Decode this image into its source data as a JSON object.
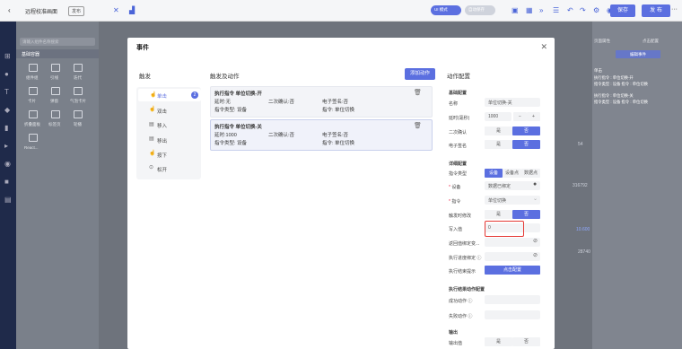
{
  "topbar": {
    "back": "‹",
    "title": "远程校准画面",
    "badge": "发布",
    "toggle1": "UI 模式",
    "toggle2": "自动保存",
    "save": "保存",
    "publish": "发 布",
    "more": "···"
  },
  "left": {
    "search_placeholder": "请输入组件名称搜索",
    "section": "基础容器",
    "items": [
      "组件组",
      "引线",
      "迭代",
      "卡片",
      "弹窗",
      "气泡卡片",
      "折叠面板",
      "标签页",
      "轮播",
      "React..."
    ]
  },
  "right": {
    "tab1": "页面属性",
    "tab2": "点击配置",
    "edit_btn": "编辑事件",
    "lines": [
      "单击",
      "执行指令 : 单位切换-开",
      "指令类型 : 设备    指令 : 单位切换",
      "执行指令 : 单位切换-关",
      "指令类型 : 设备    指令 : 单位切换"
    ]
  },
  "canvas": {
    "vals": [
      "54",
      "316792",
      "10.600",
      "28740"
    ]
  },
  "modal": {
    "title": "事件",
    "close": "✕",
    "trigger_h": "触发",
    "triggers": [
      {
        "label": "单击",
        "count": "2"
      },
      {
        "label": "双击"
      },
      {
        "label": "移入"
      },
      {
        "label": "移出"
      },
      {
        "label": "按下"
      },
      {
        "label": "松开"
      }
    ],
    "actions_h": "触发及动作",
    "add_btn": "添加动作",
    "cards": [
      {
        "title": "执行指令   单位切换-开",
        "delay": "延时:无",
        "confirm": "二次确认:否",
        "sign": "电子签名:否",
        "type": "指令类型: 设备",
        "cmd": "指令: 单位切换"
      },
      {
        "title": "执行指令   单位切换-关",
        "delay": "延时:1000",
        "confirm": "二次确认:否",
        "sign": "电子签名:否",
        "type": "指令类型: 设备",
        "cmd": "指令: 单位切换"
      }
    ],
    "config_h": "动作配置",
    "basic_h": "基础配置",
    "name_label": "名称",
    "name_val": "单位切换-关",
    "delay_label": "延时(毫秒)",
    "delay_val": "1000",
    "minus": "−",
    "plus": "+",
    "confirm_label": "二次确认",
    "sign_label": "电子签名",
    "yes": "是",
    "no": "否",
    "detail_h": "详细配置",
    "cmdtype_label": "指令类型",
    "cmdtype_opts": [
      "设备",
      "设备点",
      "数据点"
    ],
    "device_label": "设备",
    "device_val": "数据已绑定",
    "cmd_label": "指令",
    "cmd_val": "单位切换",
    "trigger_mod_label": "触发时修改",
    "write_label": "写入值",
    "write_val": "0",
    "return_label": "返回值绑定变...",
    "exec_result_label": "执行进度绑定",
    "exec_tip_label": "执行结束提示",
    "exec_tip_btn": "点击配置",
    "after_h": "执行结果动作配置",
    "success_label": "成功动作",
    "fail_label": "失败动作",
    "output_h": "输出",
    "output_label": "输出值",
    "out_yes": "是",
    "out_no": "否"
  }
}
